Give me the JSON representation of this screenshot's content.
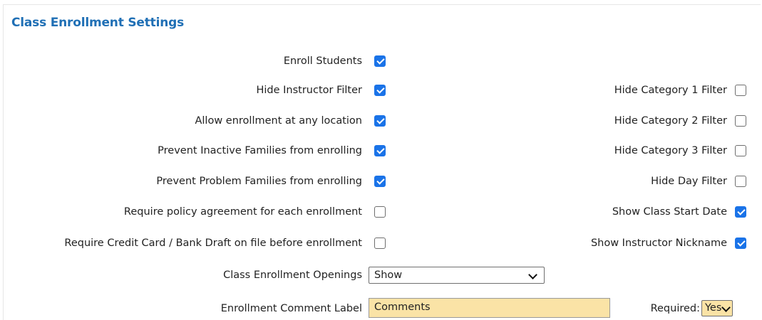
{
  "section": {
    "title": "Class Enrollment Settings"
  },
  "left_options": [
    {
      "label": "Enroll Students",
      "checked": true
    },
    {
      "label": "Hide Instructor Filter",
      "checked": true
    },
    {
      "label": "Allow enrollment at any location",
      "checked": true
    },
    {
      "label": "Prevent Inactive Families from enrolling",
      "checked": true
    },
    {
      "label": "Prevent Problem Families from enrolling",
      "checked": true
    },
    {
      "label": "Require policy agreement for each enrollment",
      "checked": false
    },
    {
      "label": "Require Credit Card / Bank Draft on file before enrollment",
      "checked": false
    }
  ],
  "right_options": [
    {
      "label": "Hide Category 1 Filter",
      "checked": false
    },
    {
      "label": "Hide Category 2 Filter",
      "checked": false
    },
    {
      "label": "Hide Category 3 Filter",
      "checked": false
    },
    {
      "label": "Hide Day Filter",
      "checked": false
    },
    {
      "label": "Show Class Start Date",
      "checked": true
    },
    {
      "label": "Show Instructor Nickname",
      "checked": true
    }
  ],
  "openings": {
    "label": "Class Enrollment Openings",
    "value": "Show"
  },
  "comment": {
    "label": "Enrollment Comment Label",
    "value": "Comments",
    "required_label": "Required:",
    "required_value": "Yes"
  },
  "colors": {
    "title": "#1f6fb5",
    "checkbox_checked": "#1a73e8",
    "input_background": "#fae3a6"
  }
}
